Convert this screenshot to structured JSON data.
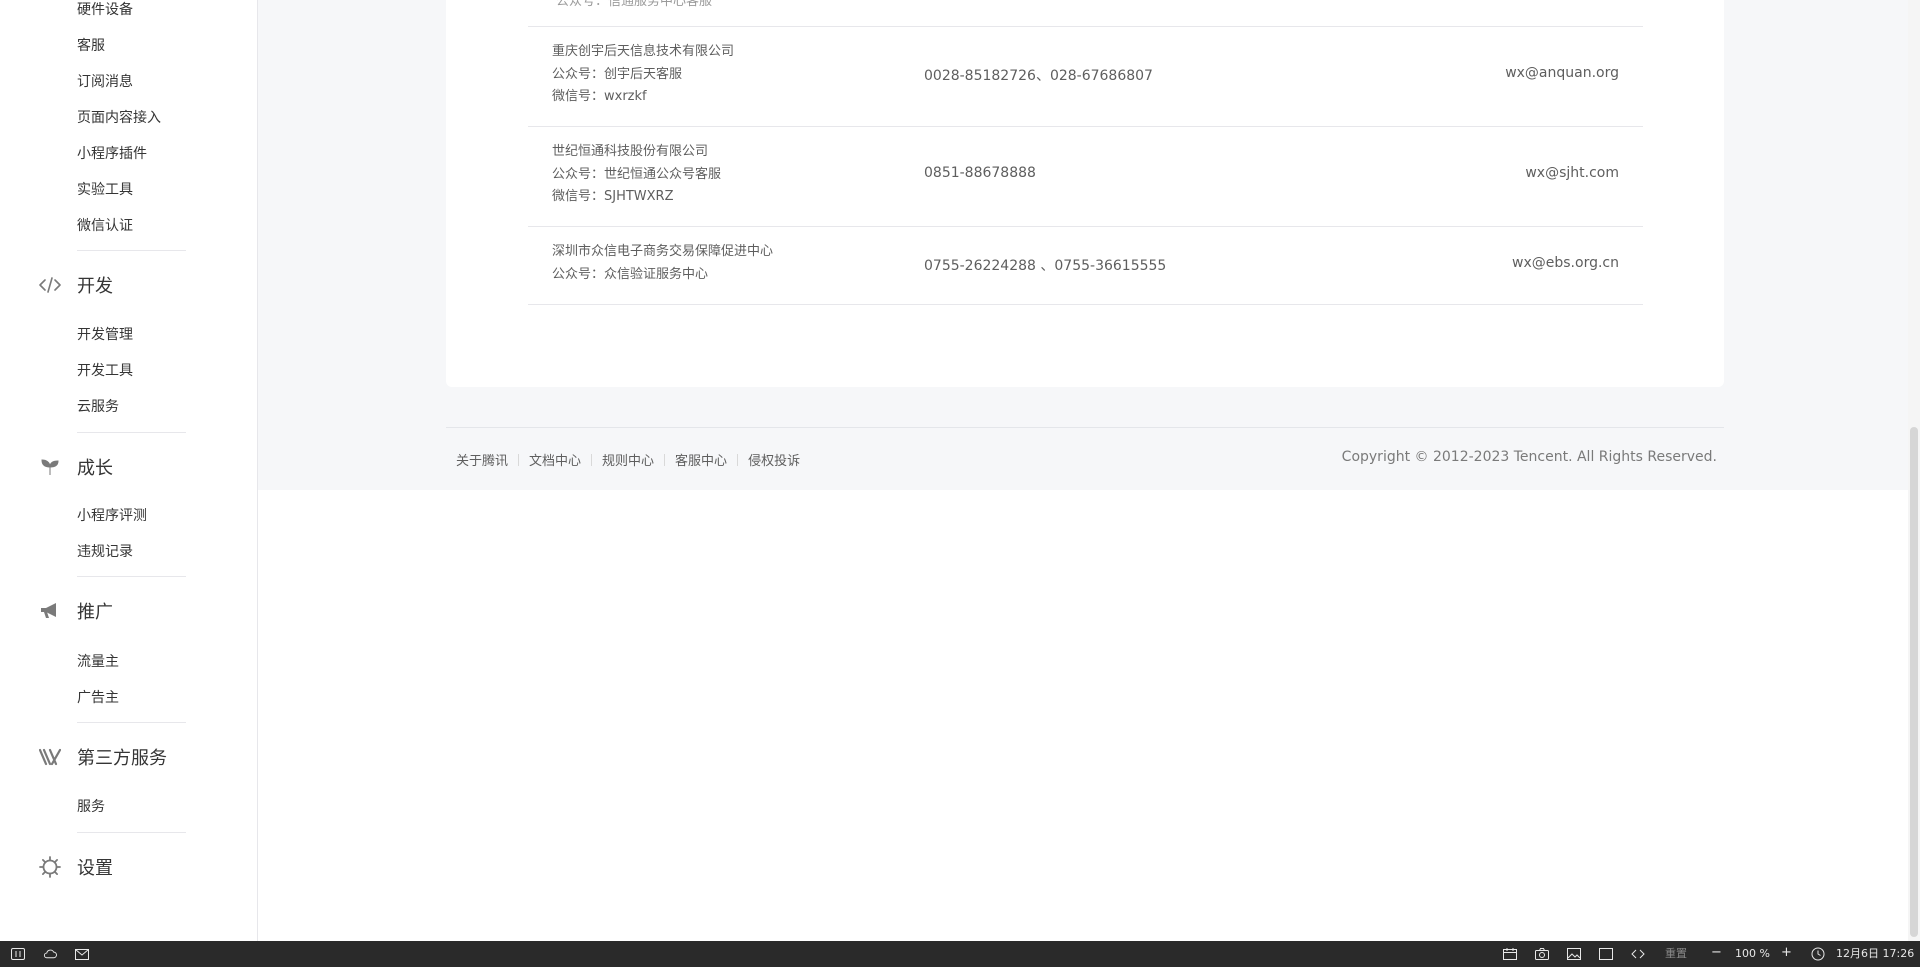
{
  "sidebar": {
    "top_items": [
      "硬件设备",
      "客服",
      "订阅消息",
      "页面内容接入",
      "小程序插件",
      "实验工具",
      "微信认证"
    ],
    "sections": [
      {
        "title": "开发",
        "icon": "code-icon",
        "items": [
          "开发管理",
          "开发工具",
          "云服务"
        ]
      },
      {
        "title": "成长",
        "icon": "sprout-icon",
        "items": [
          "小程序评测",
          "违规记录"
        ]
      },
      {
        "title": "推广",
        "icon": "megaphone-icon",
        "items": [
          "流量主",
          "广告主"
        ]
      },
      {
        "title": "第三方服务",
        "icon": "third-party-icon",
        "items": [
          "服务"
        ]
      },
      {
        "title": "设置",
        "icon": "gear-icon",
        "items": []
      }
    ]
  },
  "table": {
    "partial_top_text": "公众号：信通服务中心客服",
    "rows": [
      {
        "company": "重庆创宇后天信息技术有限公司",
        "account": "公众号：创宇后天客服",
        "wechat": "微信号：wxrzkf",
        "phone": "0028-85182726、028-67686807",
        "email": "wx@anquan.org"
      },
      {
        "company": "世纪恒通科技股份有限公司",
        "account": "公众号：世纪恒通公众号客服",
        "wechat": "微信号：SJHTWXRZ",
        "phone": "0851-88678888",
        "email": "wx@sjht.com"
      },
      {
        "company": "深圳市众信电子商务交易保障促进中心",
        "account": "公众号：众信验证服务中心",
        "wechat": "",
        "phone": "0755-26224288 、0755-36615555",
        "email": "wx@ebs.org.cn"
      }
    ]
  },
  "footer": {
    "links": [
      "关于腾讯",
      "文档中心",
      "规则中心",
      "客服中心",
      "侵权投诉"
    ],
    "copyright": "Copyright © 2012-2023 Tencent. All Rights Reserved."
  },
  "taskbar": {
    "reset_label": "重置",
    "zoom": "100 %",
    "datetime": "12月6日 17:26"
  }
}
